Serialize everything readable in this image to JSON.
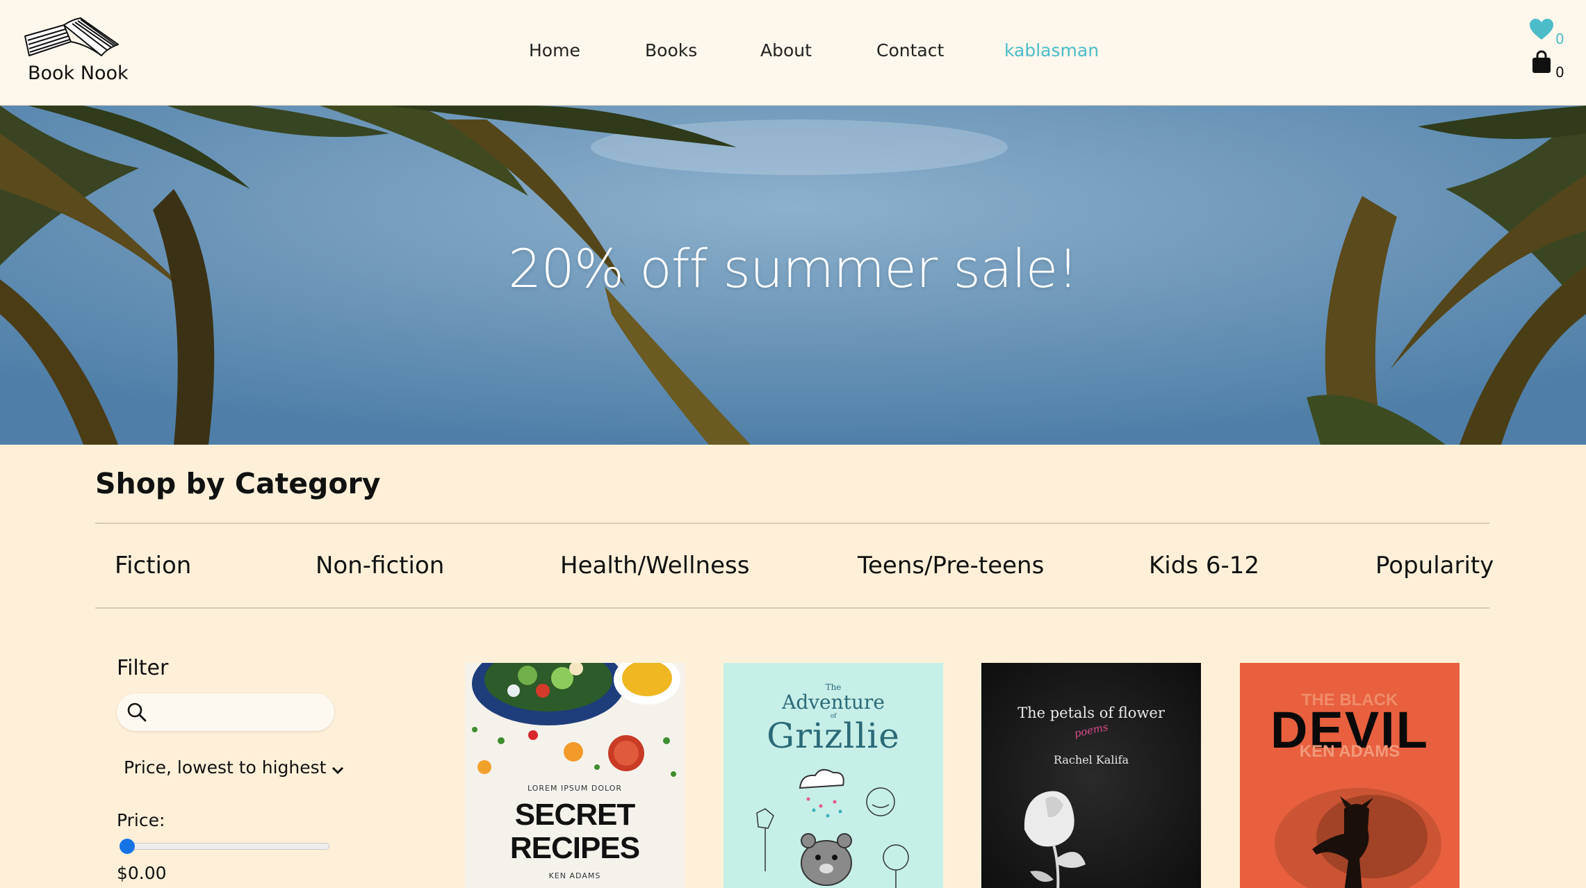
{
  "header": {
    "logo_text": "Book Nook",
    "nav": [
      "Home",
      "Books",
      "About",
      "Contact",
      "kablasman"
    ],
    "favorites_count": "0",
    "cart_count": "0",
    "colors": {
      "accent": "#4cbcc8",
      "header_bg": "#fef7ec"
    }
  },
  "hero": {
    "title": "20% off summer sale!"
  },
  "categories": {
    "title": "Shop by Category",
    "tabs": [
      "Fiction",
      "Non-fiction",
      "Health/Wellness",
      "Teens/Pre-teens",
      "Kids 6-12",
      "Popularity"
    ]
  },
  "filter": {
    "title": "Filter",
    "search_value": "",
    "sort_selected": "Price, lowest to highest",
    "price_label": "Price:",
    "price_value": "$0.00",
    "price_slider_fraction": 0
  },
  "books": [
    {
      "small_top": "LOREM IPSUM DOLOR",
      "title_line1": "SECRET",
      "title_line2": "RECIPES",
      "author": "KEN ADAMS"
    },
    {
      "title_the": "The",
      "title_main": "Adventure",
      "title_of": "of",
      "title_name": "Grizllie"
    },
    {
      "title": "The petals of flower",
      "subtitle": "poems",
      "author": "Rachel Kalifa"
    },
    {
      "title_top": "THE BLACK",
      "title_main": "DEVIL",
      "author": "KEN ADAMS"
    }
  ],
  "icons": [
    "book-logo-icon",
    "heart-icon",
    "shopping-bag-icon",
    "search-icon",
    "chevron-down-icon"
  ]
}
